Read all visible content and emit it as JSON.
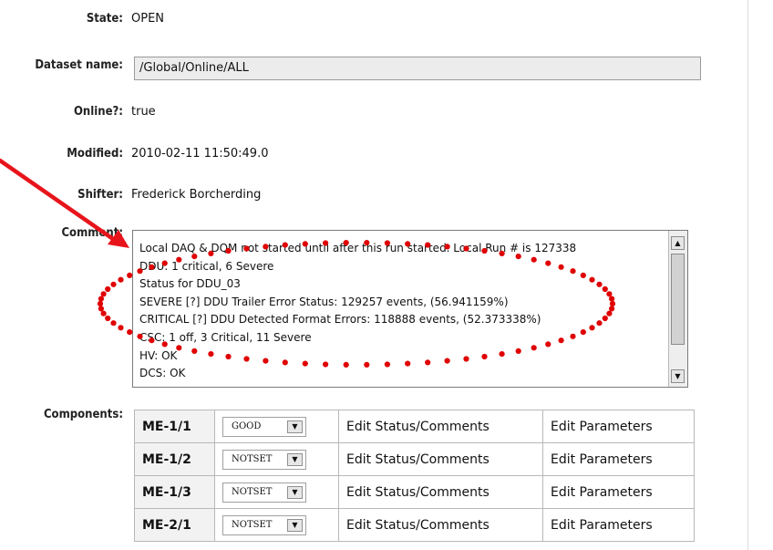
{
  "fields": {
    "state_label": "State:",
    "state_value": "OPEN",
    "dataset_label": "Dataset name:",
    "dataset_value": "/Global/Online/ALL",
    "online_label": "Online?:",
    "online_value": "true",
    "modified_label": "Modified:",
    "modified_value": "2010-02-11 11:50:49.0",
    "shifter_label": "Shifter:",
    "shifter_value": "Frederick Borcherding",
    "comment_label": "Comment:"
  },
  "comment": {
    "lines": [
      "Local DAQ & DQM not started until after this run started.  Local Run # is 127338",
      "DDU: 1 critical, 6 Severe",
      "Status for DDU_03",
      "SEVERE    [?] DDU Trailer Error Status: 129257 events, (56.941159%)",
      "CRITICAL    [?] DDU Detected Format Errors: 118888 events, (52.373338%)",
      "CSC: 1 off, 3 Critical, 11 Severe",
      "HV: OK",
      "DCS: OK"
    ]
  },
  "components": {
    "label": "Components:",
    "rows": [
      {
        "name": "ME-1/1",
        "status": "GOOD",
        "edit": "Edit Status/Comments",
        "params": "Edit Parameters"
      },
      {
        "name": "ME-1/2",
        "status": "NOTSET",
        "edit": "Edit Status/Comments",
        "params": "Edit Parameters"
      },
      {
        "name": "ME-1/3",
        "status": "NOTSET",
        "edit": "Edit Status/Comments",
        "params": "Edit Parameters"
      },
      {
        "name": "ME-2/1",
        "status": "NOTSET",
        "edit": "Edit Status/Comments",
        "params": "Edit Parameters"
      }
    ]
  },
  "annotation": {
    "arrow_color": "#e8141b",
    "dots_color": "#e00000"
  },
  "icons": {
    "scroll_up": "scroll-up-arrow-icon",
    "scroll_down": "scroll-down-arrow-icon",
    "dropdown": "dropdown-arrow-icon"
  }
}
